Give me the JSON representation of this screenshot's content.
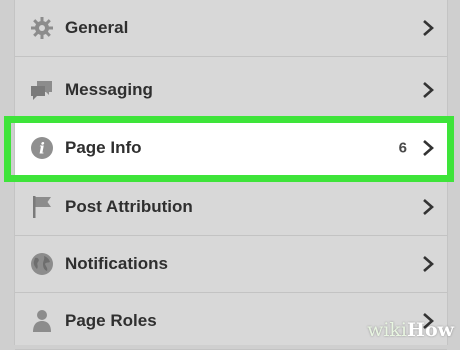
{
  "settings_menu": {
    "items": [
      {
        "label": "General",
        "icon": "gear-icon",
        "count": ""
      },
      {
        "label": "Messaging",
        "icon": "chat-bubbles-icon",
        "count": ""
      },
      {
        "label": "Page Info",
        "icon": "info-icon",
        "count": "6"
      },
      {
        "label": "Post Attribution",
        "icon": "flag-icon",
        "count": ""
      },
      {
        "label": "Notifications",
        "icon": "globe-icon",
        "count": ""
      },
      {
        "label": "Page Roles",
        "icon": "person-icon",
        "count": ""
      }
    ]
  },
  "colors": {
    "highlight_border": "#3ee43a",
    "selected_row_bg": "#ffffff",
    "row_bg": "#d8d8d8",
    "text": "#2f2f2f"
  },
  "watermark": {
    "part1": "wiki",
    "part2": "How"
  }
}
